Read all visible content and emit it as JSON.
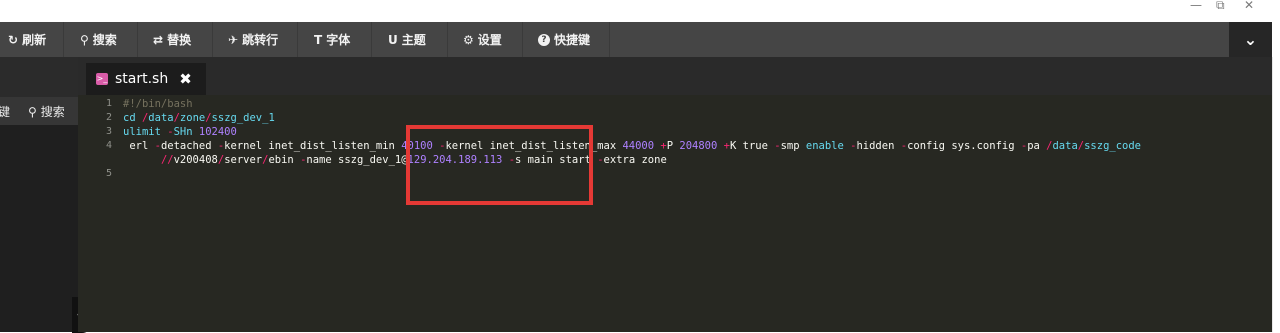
{
  "window": {
    "minimize": "—",
    "restore": "⧉",
    "close": "✕"
  },
  "toolbar": {
    "items": [
      {
        "label": "刷新",
        "icon": "↻"
      },
      {
        "label": "搜索",
        "icon": "⚲"
      },
      {
        "label": "替换",
        "icon": "⇄"
      },
      {
        "label": "跳转行",
        "icon": "✈"
      },
      {
        "label": "字体",
        "icon": "T"
      },
      {
        "label": "主题",
        "icon": "U"
      },
      {
        "label": "设置",
        "icon": "⚙"
      },
      {
        "label": "快捷键",
        "icon": "?"
      }
    ],
    "collapse_icon": "⌄"
  },
  "sidebar": {
    "key_label": "键",
    "search_label": "搜索",
    "search_icon": "⚲",
    "handle_icon": "<"
  },
  "tab": {
    "name": "start.sh",
    "icon": ">_",
    "close": "✖"
  },
  "editor": {
    "line_numbers": [
      "1",
      "2",
      "3",
      "4",
      "",
      "5"
    ],
    "lines": {
      "l1": "#!/bin/bash",
      "l2_a": "cd ",
      "l2_b": "/",
      "l2_c": "data",
      "l2_d": "/",
      "l2_e": "zone",
      "l2_f": "/",
      "l2_g": "sszg_dev_1",
      "l3_a": "ulimit ",
      "l3_b": "-",
      "l3_c": "SHn ",
      "l3_d": "102400",
      "l4_a": " erl ",
      "l4_b": "-",
      "l4_c": "detached ",
      "l4_d": "-",
      "l4_e": "kernel inet_dist_listen_min ",
      "l4_f": "40100",
      "l4_g": " ",
      "l4_h": "-",
      "l4_i": "kernel inet_dist_listen_max ",
      "l4_j": "44000",
      "l4_k": " ",
      "l4_l": "+",
      "l4_m": "P ",
      "l4_n": "204800",
      "l4_o": " ",
      "l4_p": "+",
      "l4_q": "K true ",
      "l4_r": "-",
      "l4_s": "smp ",
      "l4_t": "enable",
      "l4_u": " ",
      "l4_v": "-",
      "l4_w": "hidden ",
      "l4_x": "-",
      "l4_y": "config sys.config ",
      "l4_z": "-",
      "l4_aa": "pa ",
      "l4_ab": "/",
      "l4_ac": "data",
      "l4_ad": "/",
      "l4_ae": "sszg_code",
      "l4w_a": "      ",
      "l4w_b": "//",
      "l4w_c": "v200408",
      "l4w_d": "/",
      "l4w_e": "server",
      "l4w_f": "/",
      "l4w_g": "ebin ",
      "l4w_h": "-",
      "l4w_i": "name sszg_dev_1@",
      "l4w_j": "129.204.189.113",
      "l4w_k": " ",
      "l4w_l": "-",
      "l4w_m": "s main start ",
      "l4w_n": "-",
      "l4w_o": "extra zone"
    }
  },
  "colors": {
    "highlight_box": "#e53935",
    "toolbar_bg": "#454545",
    "editor_bg": "#272822"
  }
}
